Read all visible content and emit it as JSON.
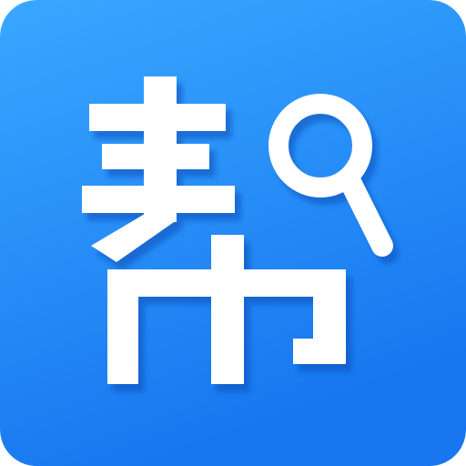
{
  "icon": {
    "character": "帮",
    "symbol": "magnifier-icon",
    "gradient_top": "#39a8ff",
    "gradient_bottom": "#1776f0",
    "glyph_color": "#ffffff",
    "shadow_color": "#0b4fb8"
  }
}
